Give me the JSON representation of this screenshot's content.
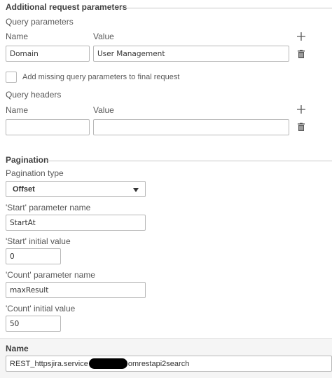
{
  "request_params": {
    "title": "Additional request parameters",
    "query_params": {
      "heading": "Query parameters",
      "name_col": "Name",
      "value_col": "Value",
      "row": {
        "name": "Domain",
        "value": "User Management"
      },
      "add_icon": "plus-icon",
      "delete_icon": "trash-icon"
    },
    "add_missing_label": "Add missing query parameters to final request",
    "add_missing_checked": false,
    "query_headers": {
      "heading": "Query headers",
      "name_col": "Name",
      "value_col": "Value",
      "row": {
        "name": "",
        "value": ""
      },
      "add_icon": "plus-icon",
      "delete_icon": "trash-icon"
    }
  },
  "pagination": {
    "title": "Pagination",
    "type_label": "Pagination type",
    "type_value": "Offset",
    "start_param_label": "'Start' parameter name",
    "start_param_value": "StartAt",
    "start_initial_label": "'Start' initial value",
    "start_initial_value": "0",
    "count_param_label": "'Count' parameter name",
    "count_param_value": "maxResult",
    "count_initial_label": "'Count' initial value",
    "count_initial_value": "50"
  },
  "connection_name": {
    "title": "Name",
    "value_prefix": "REST_httpsjira.service",
    "value_suffix": "omrestapi2search"
  },
  "colors": {
    "text": "#404040",
    "border": "#b8b8b8",
    "redaction": "#000000"
  }
}
